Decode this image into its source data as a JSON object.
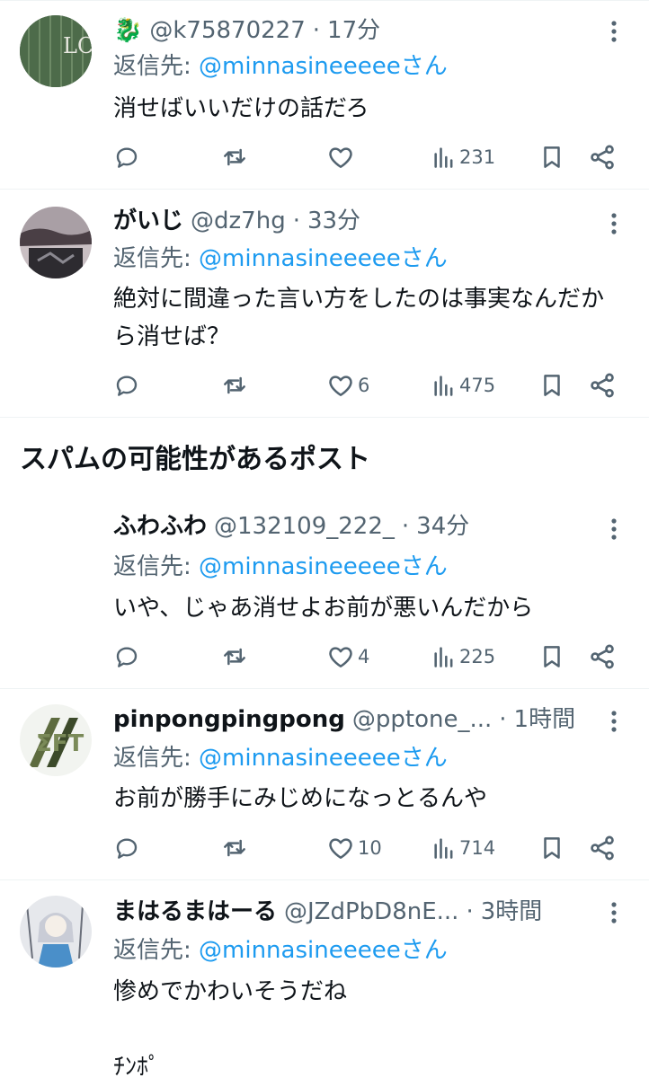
{
  "reply_prefix": "返信先: ",
  "posts": [
    {
      "emoji": "🐉",
      "name": "",
      "handle": "@k75870227",
      "dot": "·",
      "time": "17分",
      "mention": "@minnasineeeeeさん",
      "text": "消せばいいだけの話だろ",
      "likes": "",
      "views": "231"
    },
    {
      "name": "がいじ",
      "handle": "@dz7hg",
      "dot": "·",
      "time": "33分",
      "mention": "@minnasineeeeeさん",
      "text": "絶対に間違った言い方をしたのは事実なんだから消せば？",
      "likes": "6",
      "views": "475"
    },
    {
      "name": "ふわふわ",
      "handle": "@132109_222_",
      "dot": "·",
      "time": "34分",
      "mention": "@minnasineeeeeさん",
      "text": "いや、じゃあ消せよお前が悪いんだから",
      "likes": "4",
      "views": "225"
    },
    {
      "name": "pinpongpingpong",
      "handle": "@pptone_...",
      "dot": "·",
      "time": "1時間",
      "mention": "@minnasineeeeeさん",
      "text": "お前が勝手にみじめになっとるんや",
      "likes": "10",
      "views": "714"
    },
    {
      "name": "まはるまはーる",
      "handle": "@JZdPbD8nE...",
      "dot": "·",
      "time": "3時間",
      "mention": "@minnasineeeeeさん",
      "text": "惨めでかわいそうだね\n\nﾁﾝﾎﾟ",
      "likes": "",
      "views": ""
    }
  ],
  "section": {
    "title": "スパムの可能性があるポスト"
  },
  "icons": {
    "more": "more-vertical-icon",
    "reply": "reply-bubble-icon",
    "repost": "repost-icon",
    "like": "heart-icon",
    "views": "views-bar-chart-icon",
    "bookmark": "bookmark-icon",
    "share": "share-icon"
  },
  "colors": {
    "text": "#0f1419",
    "secondary": "#536471",
    "link": "#1d9bf0",
    "divider": "#eff3f4"
  }
}
